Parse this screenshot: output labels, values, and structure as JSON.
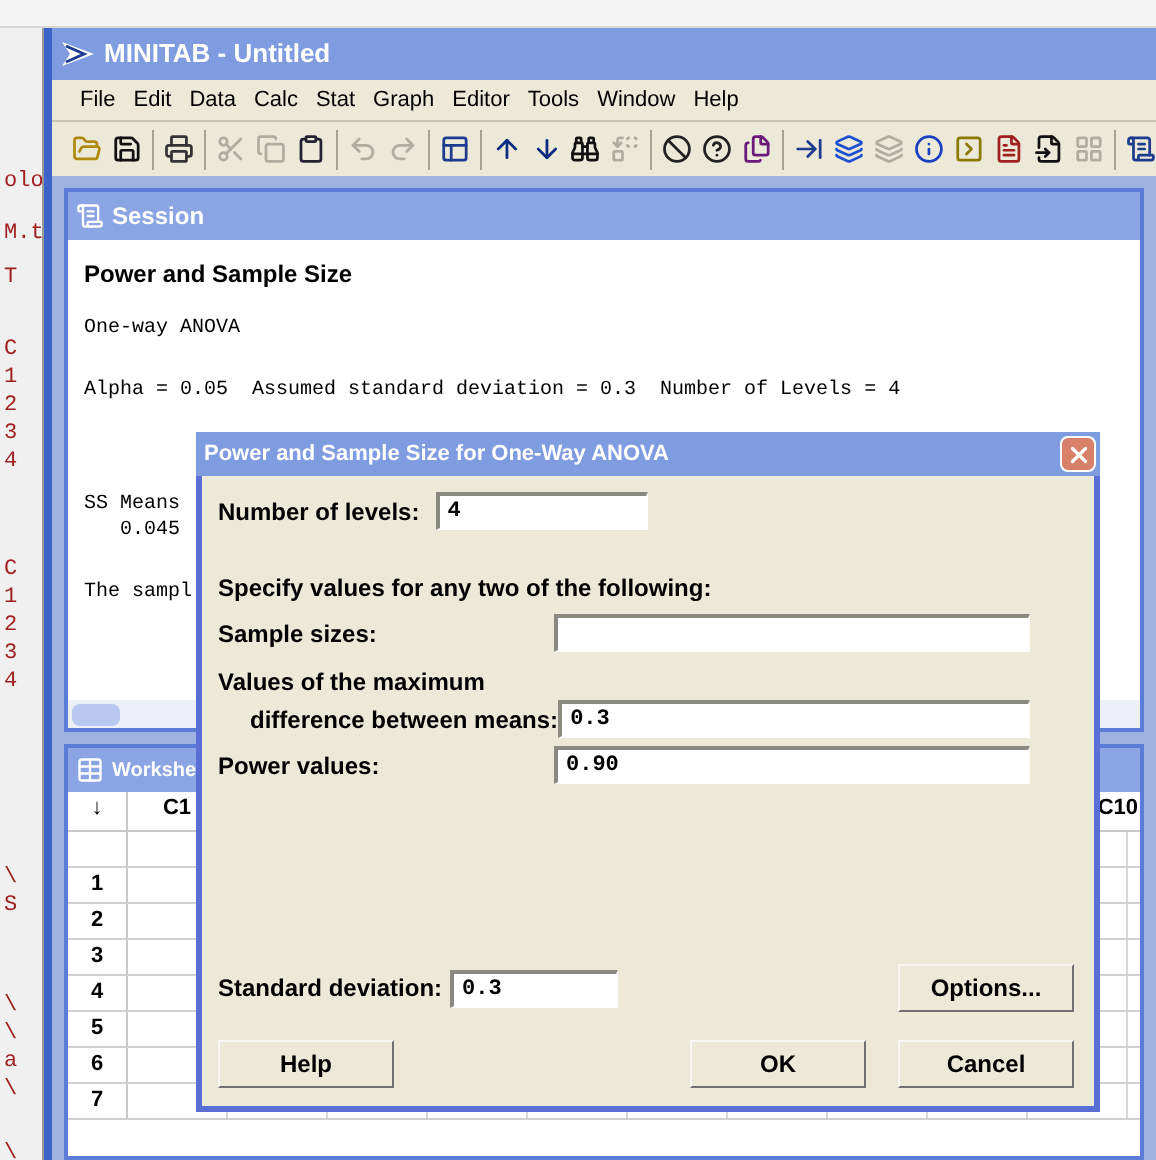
{
  "background_window": {
    "fragments": [
      "olo",
      "M.t",
      "T",
      "C",
      "1",
      "2",
      "3",
      "4",
      "C",
      "1",
      "2",
      "3",
      "4",
      "\\",
      "S",
      "\\",
      "\\",
      "a",
      "\\",
      "\\"
    ]
  },
  "window": {
    "title": "MINITAB - Untitled"
  },
  "menu": [
    "File",
    "Edit",
    "Data",
    "Calc",
    "Stat",
    "Graph",
    "Editor",
    "Tools",
    "Window",
    "Help"
  ],
  "toolbar": [
    {
      "kind": "open",
      "disabled": false
    },
    {
      "kind": "save",
      "disabled": false
    },
    {
      "kind": "sep"
    },
    {
      "kind": "print",
      "disabled": false
    },
    {
      "kind": "sep"
    },
    {
      "kind": "cut",
      "disabled": true
    },
    {
      "kind": "copy",
      "disabled": true
    },
    {
      "kind": "paste",
      "disabled": false
    },
    {
      "kind": "sep"
    },
    {
      "kind": "undo",
      "disabled": true
    },
    {
      "kind": "redo",
      "disabled": true
    },
    {
      "kind": "sep"
    },
    {
      "kind": "window",
      "disabled": false
    },
    {
      "kind": "sep"
    },
    {
      "kind": "up",
      "disabled": false
    },
    {
      "kind": "down",
      "disabled": false
    },
    {
      "kind": "find",
      "disabled": false
    },
    {
      "kind": "replace",
      "disabled": true
    },
    {
      "kind": "sep"
    },
    {
      "kind": "cancel",
      "disabled": false
    },
    {
      "kind": "help",
      "disabled": false
    },
    {
      "kind": "manager",
      "disabled": false
    },
    {
      "kind": "sep"
    },
    {
      "kind": "insert",
      "disabled": false
    },
    {
      "kind": "windows",
      "disabled": false
    },
    {
      "kind": "windows",
      "disabled": true
    },
    {
      "kind": "info",
      "disabled": false
    },
    {
      "kind": "command",
      "disabled": false
    },
    {
      "kind": "report",
      "disabled": false
    },
    {
      "kind": "append",
      "disabled": false
    },
    {
      "kind": "layout",
      "disabled": true
    },
    {
      "kind": "sep"
    },
    {
      "kind": "session",
      "disabled": false
    }
  ],
  "session": {
    "title": "Session",
    "heading": "Power and Sample Size",
    "blocks": [
      [
        "One-way ANOVA"
      ],
      [
        "Alpha = 0.05  Assumed standard deviation = 0.3  Number of Levels = 4"
      ],
      [
        "SS Means",
        "   0.045"
      ],
      [
        "The sampl"
      ]
    ]
  },
  "worksheet": {
    "title": "Workshe",
    "corner": "↓",
    "column_headers": [
      "C1",
      "C10"
    ],
    "rows": [
      "1",
      "2",
      "3",
      "4",
      "5",
      "6",
      "7"
    ]
  },
  "dialog": {
    "title": "Power and Sample Size for One-Way ANOVA",
    "levels_label": "Number of levels:",
    "levels_value": "4",
    "instruction": "Specify values for any two of the following:",
    "sample_label": "Sample sizes:",
    "diff_label_1": "Values of the maximum",
    "diff_label_2": "difference between means:",
    "diff_value": "0.3",
    "power_label": "Power values:",
    "power_value": "0.90",
    "sd_label": "Standard deviation:",
    "sd_value": "0.3",
    "buttons": [
      {
        "kind": "options",
        "label": "Options..."
      },
      {
        "kind": "help",
        "label": "Help"
      },
      {
        "kind": "ok",
        "label": "OK"
      },
      {
        "kind": "cancel",
        "label": "Cancel"
      }
    ]
  }
}
